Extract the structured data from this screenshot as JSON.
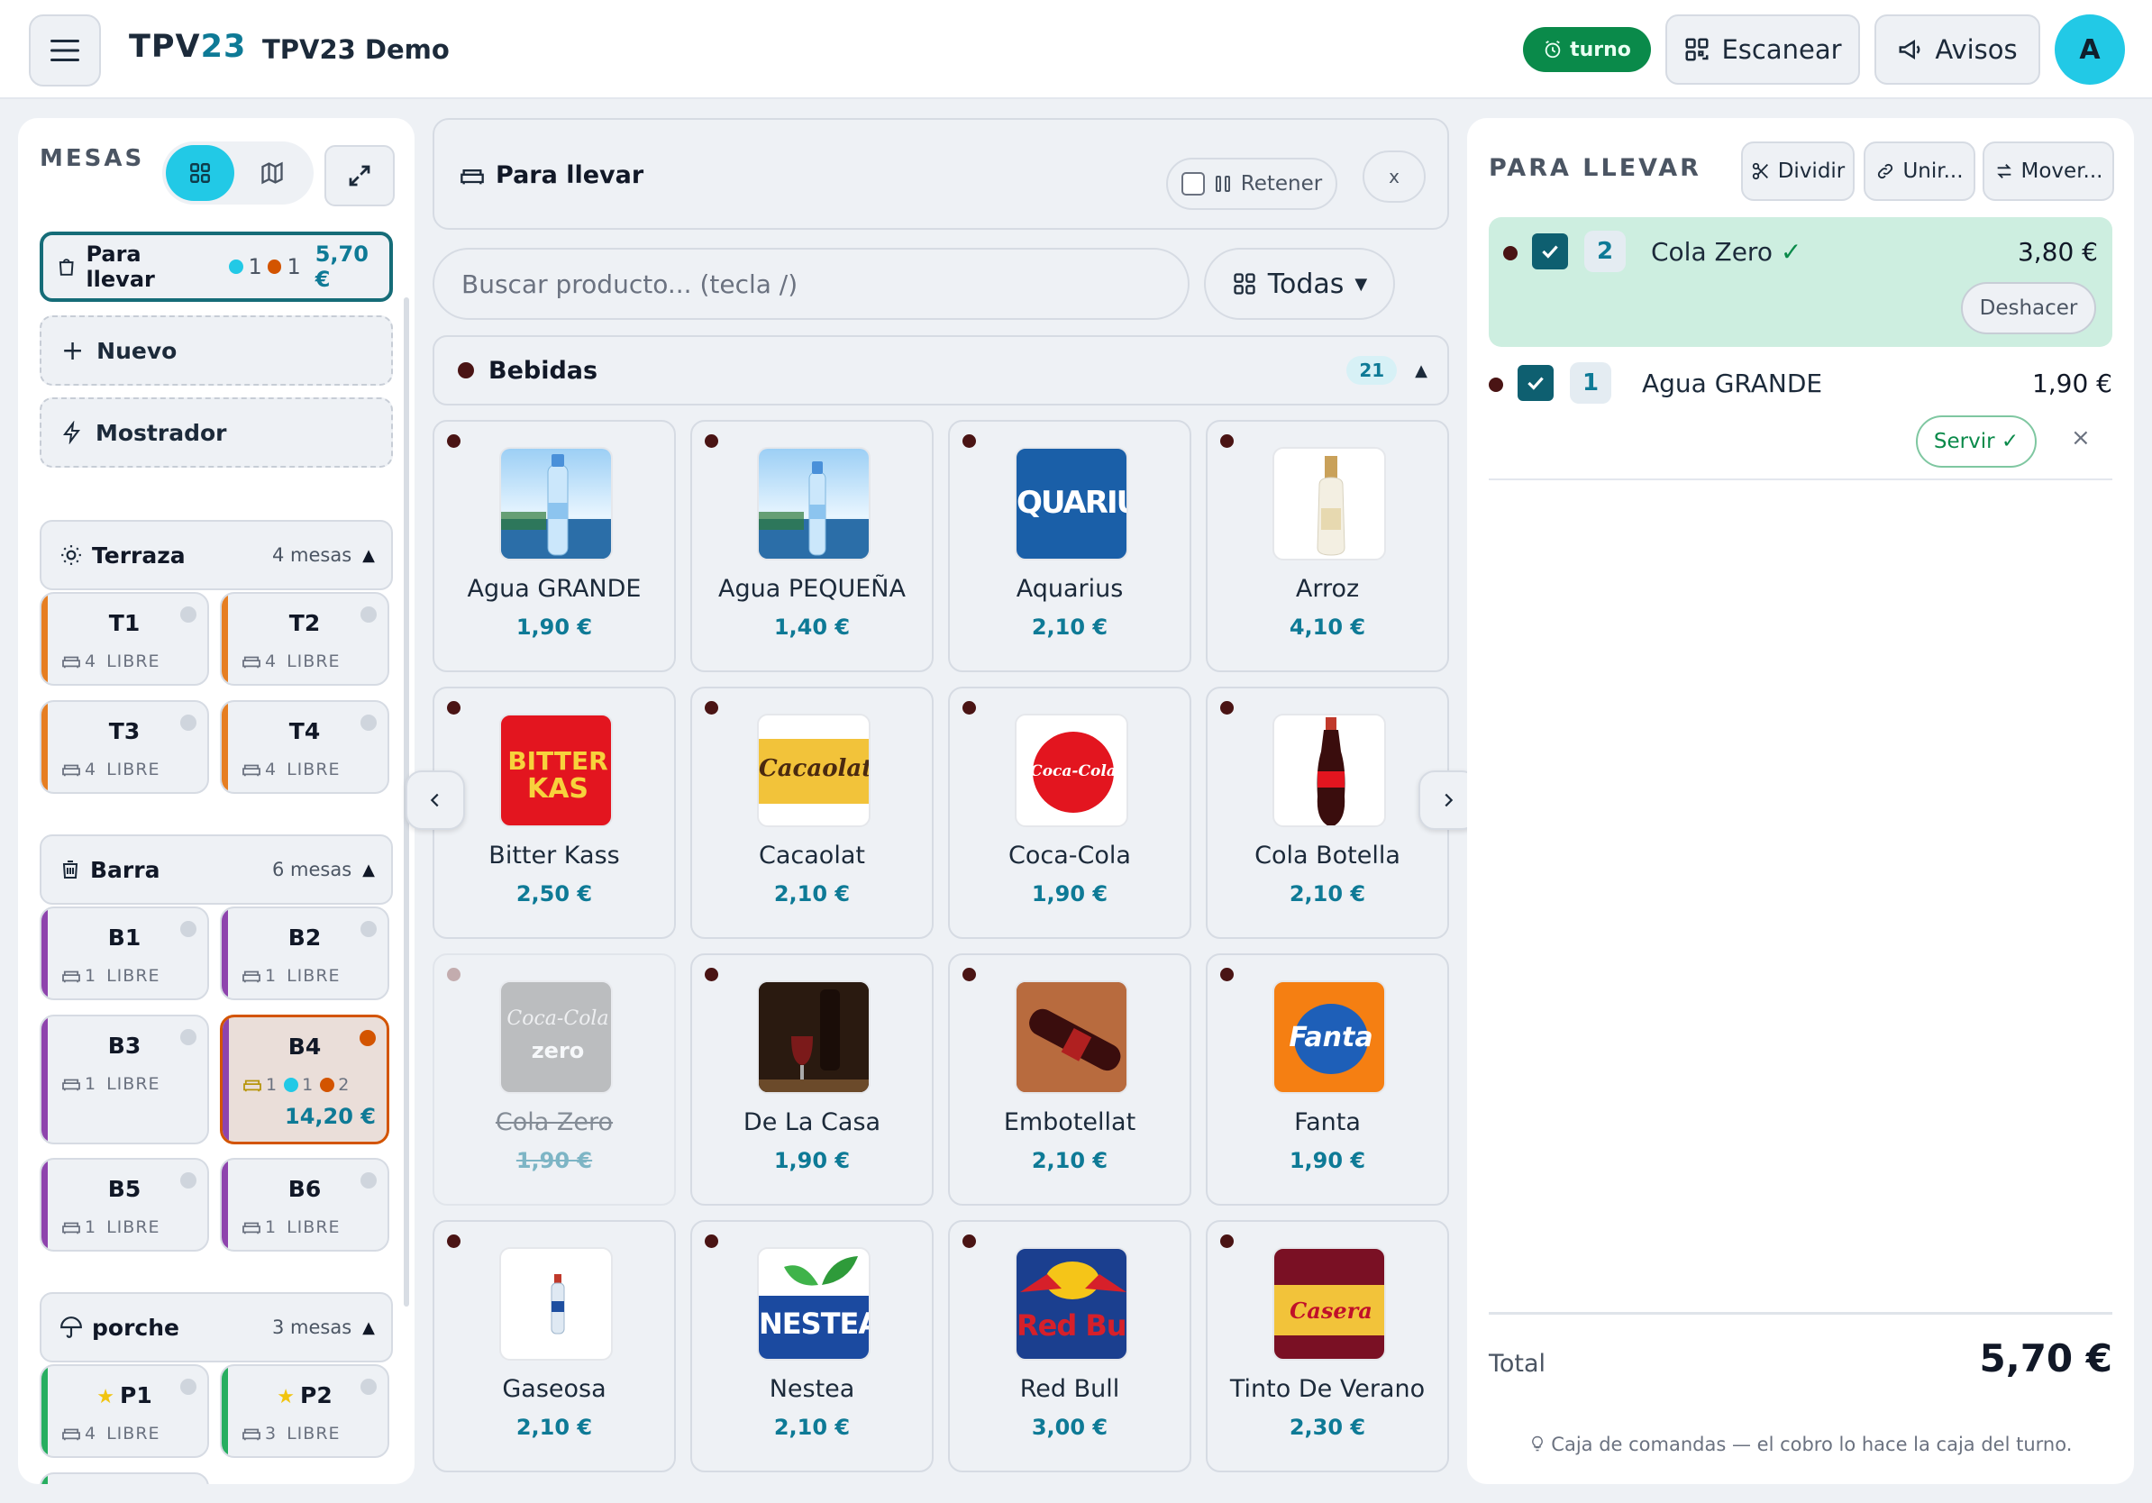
{
  "header": {
    "brand_a": "TPV",
    "brand_b": "23",
    "title": "TPV23 Demo",
    "turno": "turno",
    "scan": "Escanear",
    "avisos": "Avisos",
    "avatar": "A"
  },
  "left": {
    "mesas": "MESAS",
    "para_llevar": {
      "label": "Para llevar",
      "c1": "1",
      "c2": "1",
      "amount": "5,70 €"
    },
    "nuevo": "Nuevo",
    "mostrador": "Mostrador",
    "zones": [
      {
        "name": "Terraza",
        "count": "4 mesas",
        "tables": [
          {
            "name": "T1",
            "cap": "4",
            "state": "LIBRE"
          },
          {
            "name": "T2",
            "cap": "4",
            "state": "LIBRE"
          },
          {
            "name": "T3",
            "cap": "4",
            "state": "LIBRE"
          },
          {
            "name": "T4",
            "cap": "4",
            "state": "LIBRE"
          }
        ]
      },
      {
        "name": "Barra",
        "count": "6 mesas",
        "tables": [
          {
            "name": "B1",
            "cap": "1",
            "state": "LIBRE"
          },
          {
            "name": "B2",
            "cap": "1",
            "state": "LIBRE"
          },
          {
            "name": "B3",
            "cap": "1",
            "state": "LIBRE"
          },
          {
            "name": "B4",
            "cap": "1",
            "c1": "1",
            "c2": "2",
            "amount": "14,20 €"
          },
          {
            "name": "B5",
            "cap": "1",
            "state": "LIBRE"
          },
          {
            "name": "B6",
            "cap": "1",
            "state": "LIBRE"
          }
        ]
      },
      {
        "name": "porche",
        "count": "3 mesas",
        "tables": [
          {
            "name": "P1",
            "cap": "4",
            "state": "LIBRE"
          },
          {
            "name": "P2",
            "cap": "3",
            "state": "LIBRE"
          }
        ]
      }
    ]
  },
  "center": {
    "title": "Para llevar",
    "retener": "Retener",
    "close": "x",
    "search_placeholder": "Buscar producto... (tecla /)",
    "filter": "Todas",
    "category": "Bebidas",
    "category_count": "21",
    "products": [
      {
        "name": "Agua GRANDE",
        "price": "1,90 €"
      },
      {
        "name": "Agua PEQUEÑA",
        "price": "1,40 €"
      },
      {
        "name": "Aquarius",
        "price": "2,10 €"
      },
      {
        "name": "Arroz",
        "price": "4,10 €"
      },
      {
        "name": "Bitter Kass",
        "price": "2,50 €"
      },
      {
        "name": "Cacaolat",
        "price": "2,10 €"
      },
      {
        "name": "Coca-Cola",
        "price": "1,90 €"
      },
      {
        "name": "Cola Botella",
        "price": "2,10 €"
      },
      {
        "name": "Cola Zero",
        "price": "1,90 €"
      },
      {
        "name": "De La Casa",
        "price": "1,90 €"
      },
      {
        "name": "Embotellat",
        "price": "2,10 €"
      },
      {
        "name": "Fanta",
        "price": "1,90 €"
      },
      {
        "name": "Gaseosa",
        "price": "2,10 €"
      },
      {
        "name": "Nestea",
        "price": "2,10 €"
      },
      {
        "name": "Red Bull",
        "price": "3,00 €"
      },
      {
        "name": "Tinto De Verano",
        "price": "2,30 €"
      }
    ],
    "img_text": {
      "aquarius": "QUARIU",
      "bitter1": "BITTER",
      "bitter2": "KAS",
      "cacaolat": "Cacaolat",
      "coca": "Coca-Cola",
      "zero": "zero",
      "fanta": "Fanta",
      "nestea": "NESTEA",
      "redbull": "Red Bull",
      "casera": "Casera"
    }
  },
  "right": {
    "title": "PARA LLEVAR",
    "dividir": "Dividir",
    "unir": "Unir...",
    "mover": "Mover...",
    "lines": [
      {
        "qty": "2",
        "name": "Cola Zero",
        "price": "3,80 €",
        "action": "Deshacer"
      },
      {
        "qty": "1",
        "name": "Agua GRANDE",
        "price": "1,90 €",
        "action": "Servir ✓"
      }
    ],
    "tick": "✓",
    "remove": "×",
    "total_label": "Total",
    "total": "5,70 €",
    "footer": "Caja de comandas — el cobro lo hace la caja del turno."
  },
  "colors": {
    "accent": "#0e7a96",
    "cyan": "#22c9e6",
    "green": "#0a8a4a",
    "orange": "#e67e22",
    "purple": "#8e44ad"
  }
}
